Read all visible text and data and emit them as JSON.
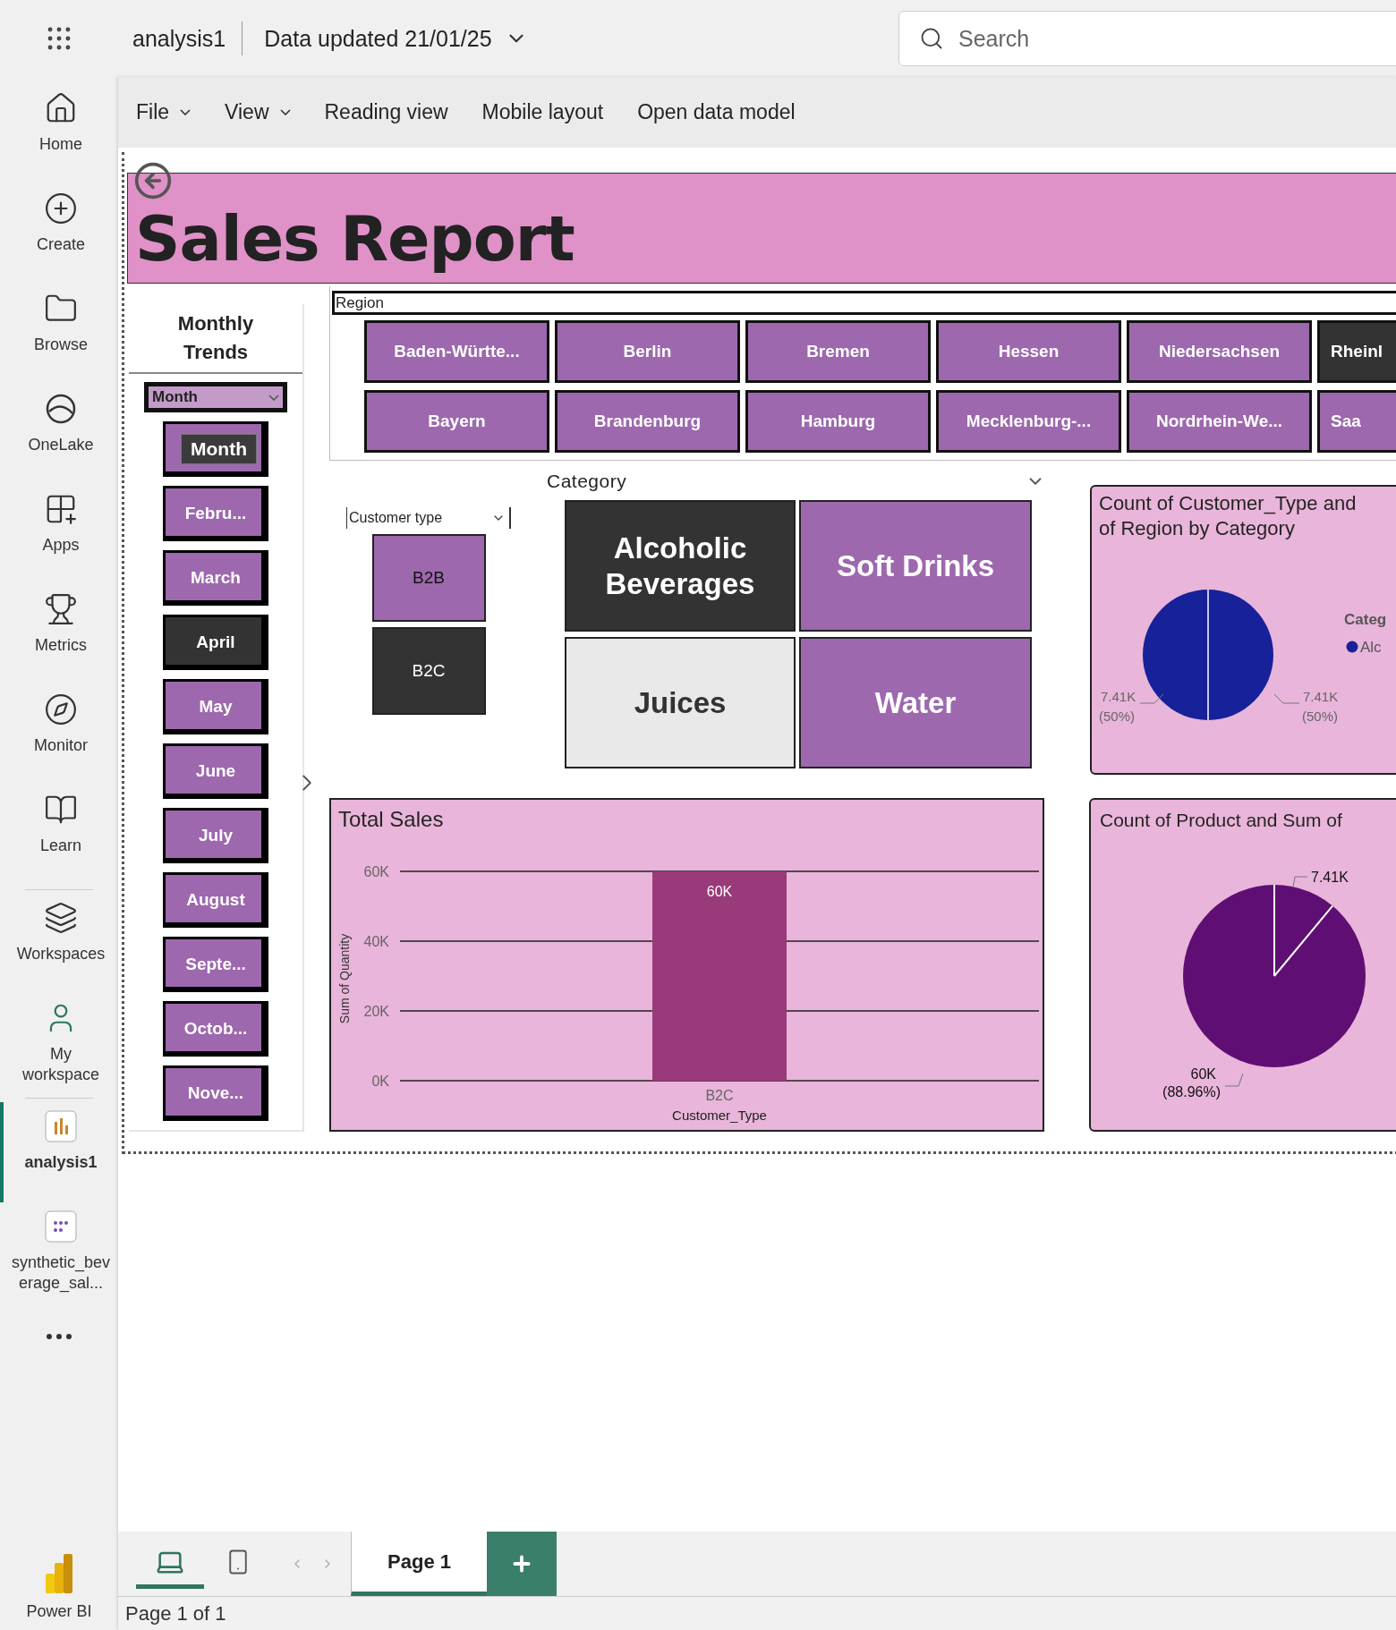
{
  "app_bar": {
    "report_name": "analysis1",
    "data_updated": "Data updated 21/01/25",
    "search": {
      "placeholder": "Search"
    }
  },
  "nav": {
    "items": [
      {
        "label": "Home",
        "kind": "home",
        "selected": false
      },
      {
        "label": "Create",
        "kind": "create",
        "selected": false
      },
      {
        "label": "Browse",
        "kind": "browse",
        "selected": false
      },
      {
        "label": "OneLake",
        "kind": "onelake",
        "selected": false
      },
      {
        "label": "Apps",
        "kind": "apps",
        "selected": false
      },
      {
        "label": "Metrics",
        "kind": "metrics",
        "selected": false
      },
      {
        "label": "Monitor",
        "kind": "monitor",
        "selected": false
      },
      {
        "label": "Learn",
        "kind": "learn",
        "selected": false
      },
      {
        "label": "Workspaces",
        "kind": "workspaces",
        "selected": false
      },
      {
        "label": "My workspace",
        "kind": "person",
        "selected": false
      },
      {
        "label": "analysis1",
        "kind": "report",
        "selected": true
      },
      {
        "label": "synthetic_beverage_sal...",
        "kind": "model",
        "selected": false
      }
    ],
    "brand": "Power BI"
  },
  "menu": [
    {
      "label": "File",
      "dropdown": true
    },
    {
      "label": "View",
      "dropdown": true
    },
    {
      "label": "Reading view",
      "dropdown": false
    },
    {
      "label": "Mobile layout",
      "dropdown": false
    },
    {
      "label": "Open data model",
      "dropdown": false
    }
  ],
  "report": {
    "title": "Sales Report",
    "month_slicer": {
      "header": "Monthly Trends",
      "dropdown": "Month",
      "tooltip": "Month",
      "items": [
        {
          "label": "Febru...",
          "selected": false
        },
        {
          "label": "March",
          "selected": false
        },
        {
          "label": "April",
          "selected": true
        },
        {
          "label": "May",
          "selected": false
        },
        {
          "label": "June",
          "selected": false
        },
        {
          "label": "July",
          "selected": false
        },
        {
          "label": "August",
          "selected": false
        },
        {
          "label": "Septe...",
          "selected": false
        },
        {
          "label": "Octob...",
          "selected": false
        },
        {
          "label": "Nove...",
          "selected": false
        }
      ]
    },
    "region_slicer": {
      "header": "Region",
      "items": [
        {
          "label": "Baden-Württe...",
          "selected": false
        },
        {
          "label": "Berlin",
          "selected": false
        },
        {
          "label": "Bremen",
          "selected": false
        },
        {
          "label": "Hessen",
          "selected": false
        },
        {
          "label": "Niedersachsen",
          "selected": false
        },
        {
          "label": "Rheinl",
          "selected": true
        },
        {
          "label": "Bayern",
          "selected": false
        },
        {
          "label": "Brandenburg",
          "selected": false
        },
        {
          "label": "Hamburg",
          "selected": false
        },
        {
          "label": "Mecklenburg-...",
          "selected": false
        },
        {
          "label": "Nordrhein-We...",
          "selected": false
        },
        {
          "label": "Saa",
          "selected": false
        }
      ]
    },
    "customer_type_slicer": {
      "header": "Customer type",
      "items": [
        {
          "label": "B2B",
          "selected": false
        },
        {
          "label": "B2C",
          "selected": true
        }
      ]
    },
    "category_slicer": {
      "header": "Category",
      "items": [
        {
          "label": "Alcoholic Beverages",
          "selected": true,
          "hovered": false
        },
        {
          "label": "Soft Drinks",
          "selected": false,
          "hovered": false
        },
        {
          "label": "Juices",
          "selected": false,
          "hovered": true
        },
        {
          "label": "Water",
          "selected": false,
          "hovered": false
        }
      ]
    },
    "total_sales": {
      "chart_data": {
        "type": "bar",
        "title": "Total Sales",
        "xlabel": "Customer_Type",
        "ylabel": "Sum of Quantity",
        "categories": [
          "B2C"
        ],
        "values": [
          60000
        ],
        "ylim": [
          0,
          60000
        ],
        "yticks": [
          {
            "value": 0,
            "label": "0K"
          },
          {
            "value": 20000,
            "label": "20K"
          },
          {
            "value": 40000,
            "label": "40K"
          },
          {
            "value": 60000,
            "label": "60K"
          }
        ],
        "value_labels": [
          "60K"
        ]
      }
    },
    "pie_customer_type": {
      "title_lines": [
        "Count of Customer_Type and",
        "of Region by Category"
      ],
      "labels": [
        {
          "value": "7.41K",
          "share": "(50%)"
        },
        {
          "value": "7.41K",
          "share": "(50%)"
        }
      ],
      "legend": {
        "title": "Categ",
        "items": [
          {
            "label": "Alc",
            "color": "#16219a"
          }
        ]
      }
    },
    "pie_product": {
      "title": "Count of Product and Sum of",
      "labels": [
        {
          "value": "7.41K"
        },
        {
          "value": "60K",
          "share": "(88.96%)"
        }
      ]
    }
  },
  "pages": {
    "views": [
      {
        "kind": "desktop",
        "selected": true
      },
      {
        "kind": "mobile",
        "selected": false
      }
    ],
    "tabs": [
      {
        "label": "Page 1",
        "selected": true
      }
    ]
  },
  "status": "Page 1 of 1"
}
